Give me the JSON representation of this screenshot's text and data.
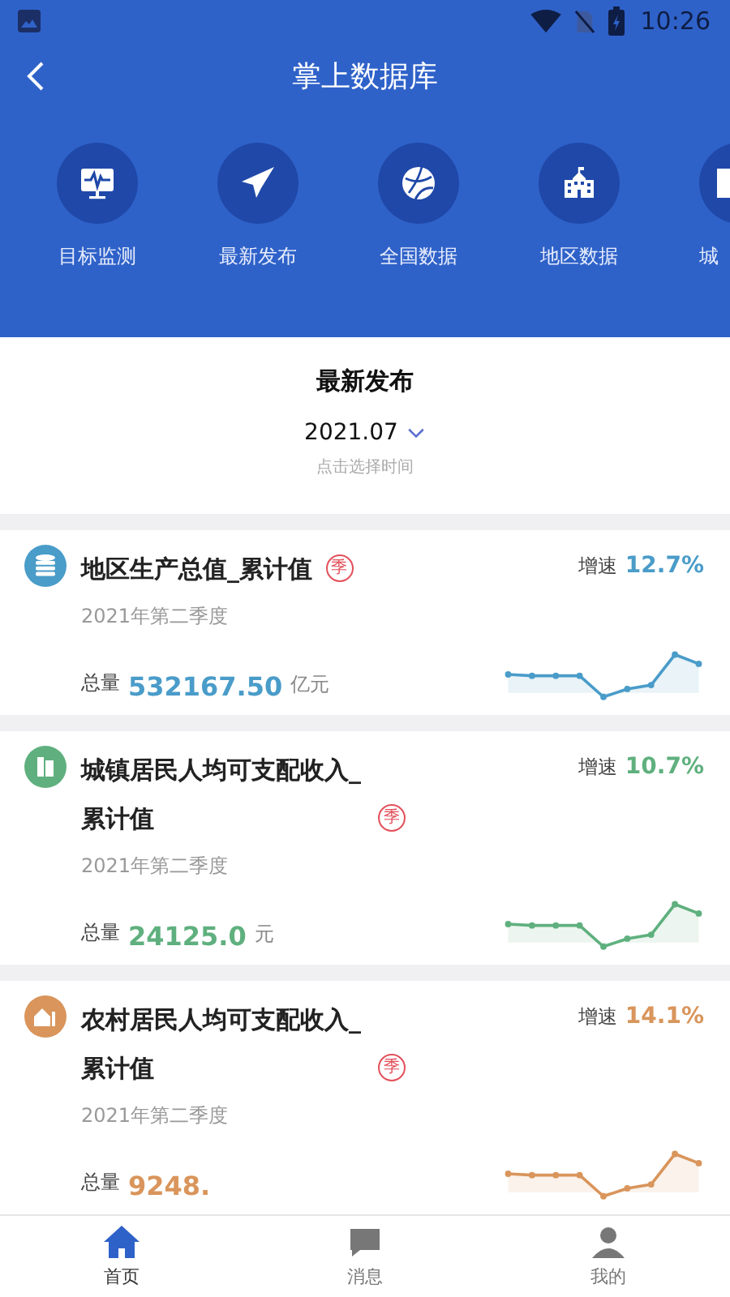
{
  "status_bar": {
    "time": "10:26"
  },
  "header": {
    "title": "掌上数据库"
  },
  "shortcuts": [
    {
      "label": "目标监测",
      "kind": "monitor"
    },
    {
      "label": "最新发布",
      "kind": "plane"
    },
    {
      "label": "全国数据",
      "kind": "globe"
    },
    {
      "label": "地区数据",
      "kind": "school"
    },
    {
      "label": "城",
      "kind": "building"
    }
  ],
  "section": {
    "title": "最新发布",
    "date": "2021.07",
    "hint": "点击选择时间"
  },
  "cards": [
    {
      "title": "地区生产总值_累计值",
      "period": "季",
      "growth_label": "增速",
      "growth": "12.7%",
      "date": "2021年第二季度",
      "total_label": "总量",
      "total": "532167.50",
      "unit": "亿元",
      "color": "#4a9cc9",
      "kind": "coins"
    },
    {
      "title": "城镇居民人均可支配收入_累计值",
      "period": "季",
      "growth_label": "增速",
      "growth": "10.7%",
      "date": "2021年第二季度",
      "total_label": "总量",
      "total": "24125.0",
      "unit": "元",
      "color": "#5fb07e",
      "kind": "city"
    },
    {
      "title": "农村居民人均可支配收入_累计值",
      "period": "季",
      "growth_label": "增速",
      "growth": "14.1%",
      "date": "2021年第二季度",
      "total_label": "总量",
      "total": "9248.",
      "color": "#d9955b",
      "kind": "house"
    }
  ],
  "nav": [
    {
      "label": "首页",
      "selected": true,
      "kind": "home"
    },
    {
      "label": "消息",
      "selected": false,
      "kind": "message"
    },
    {
      "label": "我的",
      "selected": false,
      "kind": "user"
    }
  ]
}
